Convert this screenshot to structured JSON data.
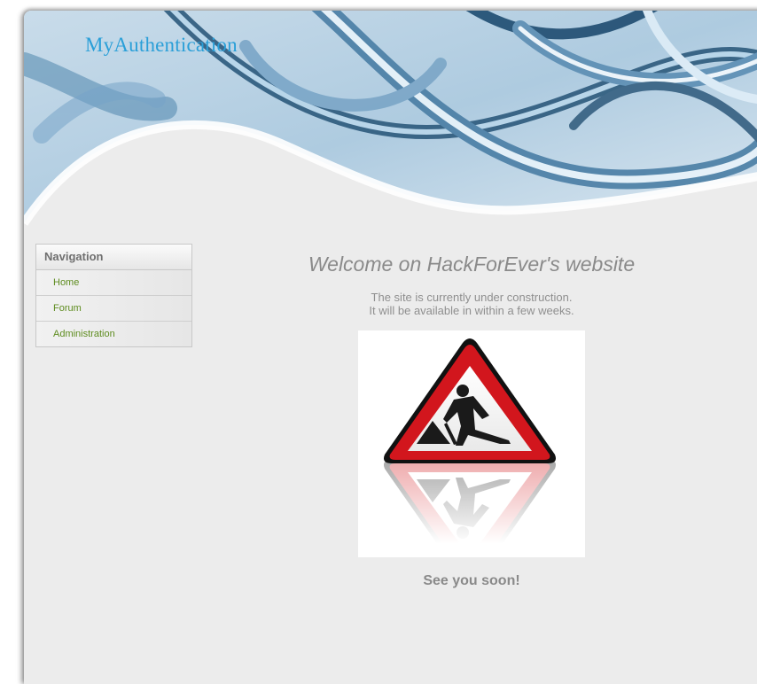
{
  "header": {
    "site_title": "MyAuthentication"
  },
  "navigation": {
    "title": "Navigation",
    "items": [
      {
        "label": "Home"
      },
      {
        "label": "Forum"
      },
      {
        "label": "Administration"
      }
    ],
    "link_color": "#5e8c1f"
  },
  "main": {
    "heading": "Welcome on HackForEver's website",
    "message_line1": "The site is currently under construction.",
    "message_line2": "It will be available in within a few weeks.",
    "image_icon": "road-works-warning-sign-icon",
    "closing": "See you soon!"
  },
  "colors": {
    "title_blue": "#2a9fd8",
    "sign_red": "#d2161d",
    "page_bg": "#ececec"
  }
}
